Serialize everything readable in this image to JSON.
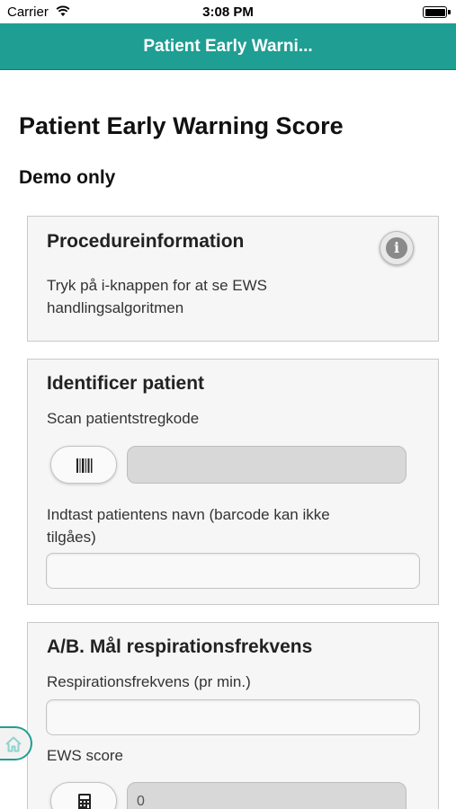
{
  "status_bar": {
    "carrier": "Carrier",
    "time": "3:08 PM"
  },
  "nav": {
    "title": "Patient Early Warni..."
  },
  "page": {
    "title": "Patient Early Warning Score",
    "subtitle": "Demo only"
  },
  "procedure_card": {
    "title": "Procedureinformation",
    "text_line1": "Tryk på i-knappen for at se EWS",
    "text_line2": "handlingsalgoritmen",
    "info_icon": "info-icon"
  },
  "identify_card": {
    "title": "Identificer patient",
    "scan_label": "Scan patientstregkode",
    "barcode_icon": "barcode-icon",
    "scan_value": "",
    "name_label_line1": "Indtast patientens navn (barcode kan ikke",
    "name_label_line2": "tilgåes)",
    "name_value": ""
  },
  "respiration_card": {
    "title": "A/B. Mål respirationsfrekvens",
    "rate_label": "Respirationsfrekvens (pr min.)",
    "rate_value": "",
    "ews_label": "EWS score",
    "calculator_icon": "calculator-icon",
    "ews_value": "0"
  },
  "home_icon": "home-icon",
  "colors": {
    "accent": "#1f9e93",
    "card_background": "#f6f6f6",
    "card_border": "#c9c9c9"
  }
}
